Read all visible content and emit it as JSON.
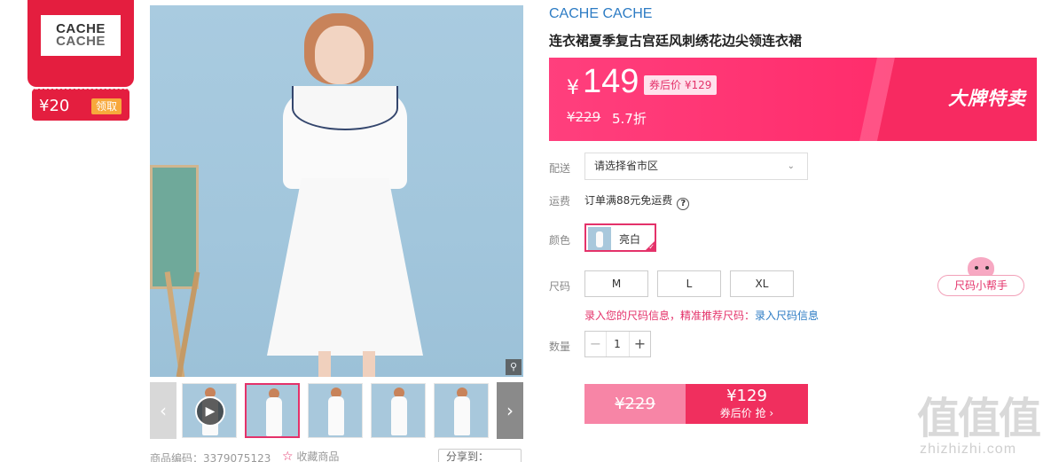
{
  "brand_card": {
    "logo_line1": "CACHE",
    "logo_line2": "CACHE",
    "coupon_amount": "¥20",
    "coupon_button": "领取"
  },
  "product": {
    "brand": "CACHE CACHE",
    "title": "连衣裙夏季复古宫廷风刺绣花边尖领连衣裙",
    "yen_symbol": "¥",
    "price": "149",
    "after_coupon": "券后价 ¥129",
    "original_price": "¥229",
    "discount": "5.7折",
    "promo_label": "大牌特卖",
    "product_code": "商品编码：3379075123",
    "favorite": "收藏商品",
    "share": "分享到："
  },
  "options": {
    "delivery_label": "配送",
    "region_placeholder": "请选择省市区",
    "shipping_label": "运费",
    "shipping_text": "订单满88元免运费",
    "color_label": "颜色",
    "color_selected": "亮白",
    "size_label": "尺码",
    "sizes": [
      "M",
      "L",
      "XL"
    ],
    "size_tip": "录入您的尺码信息，精准推荐尺码：",
    "size_tip_link": "录入尺码信息",
    "qty_label": "数量",
    "qty": "1",
    "qty_minus": "−",
    "qty_plus": "+"
  },
  "buy": {
    "original": "¥229",
    "price": "¥129",
    "cta": "券后价 抢 ›"
  },
  "size_helper": "尺码小帮手",
  "watermark": {
    "big": "值值值",
    "small": "zhizhizhi.com"
  },
  "colors": {
    "accent": "#e4326a",
    "price_banner": "#ff3f7d",
    "brand_blue": "#2d7cc4",
    "coupon_red": "#e41e3f"
  }
}
